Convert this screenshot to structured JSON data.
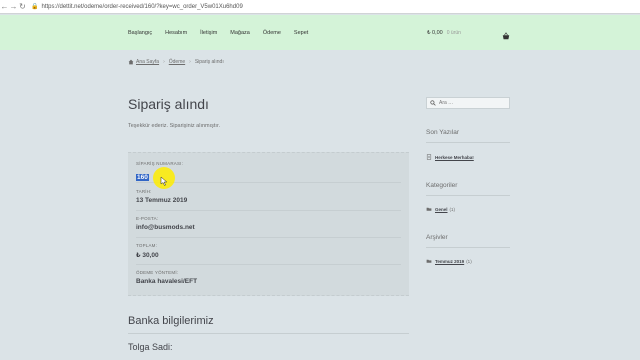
{
  "browser": {
    "back_icon": "back-arrow-icon",
    "forward_icon": "forward-arrow-icon",
    "reload_icon": "reload-icon",
    "lock_icon": "lock-icon",
    "url": "https://dettit.net/odeme/order-received/160/?key=wc_order_V5w01Xu6hd09"
  },
  "header": {
    "nav": [
      "Başlangıç",
      "Hesabım",
      "İletişim",
      "Mağaza",
      "Ödeme",
      "Sepet"
    ],
    "cart_amount": "₺ 0,00",
    "cart_count": "0 ürün",
    "cart_icon": "basket-icon"
  },
  "breadcrumb": {
    "home_icon": "home-icon",
    "items": [
      "Ana Sayfa",
      "Ödeme",
      "Sipariş alındı"
    ]
  },
  "main": {
    "title": "Sipariş alındı",
    "thanks": "Teşekkür ederiz. Siparişiniz alınmıştır.",
    "order_overview": [
      {
        "label": "SİPARİŞ NUMARASI:",
        "value": "160",
        "selected": true
      },
      {
        "label": "TARİH:",
        "value": "13 Temmuz 2019"
      },
      {
        "label": "E-POSTA:",
        "value": "info@busmods.net"
      },
      {
        "label": "TOPLAM:",
        "value": "₺ 30,00"
      },
      {
        "label": "ÖDEME YÖNTEMİ:",
        "value": "Banka havalesi/EFT"
      }
    ],
    "bank_title": "Banka bilgilerimiz",
    "bank_holder": "Tolga Sadi:"
  },
  "sidebar": {
    "search_placeholder": "Ara …",
    "search_icon": "search-icon",
    "recent_title": "Son Yazılar",
    "recent_items": [
      "Herkese Merhaba!"
    ],
    "categories_title": "Kategoriler",
    "categories": [
      {
        "name": "Genel",
        "count": "(1)"
      }
    ],
    "archives_title": "Arşivler",
    "archives": [
      {
        "name": "Temmuz 2019",
        "count": "(1)"
      }
    ]
  },
  "colors": {
    "header_bg": "#d4f3d8",
    "page_bg": "#dbe3e7",
    "selection": "#3166c6",
    "cursor_highlight": "#ffec00"
  }
}
